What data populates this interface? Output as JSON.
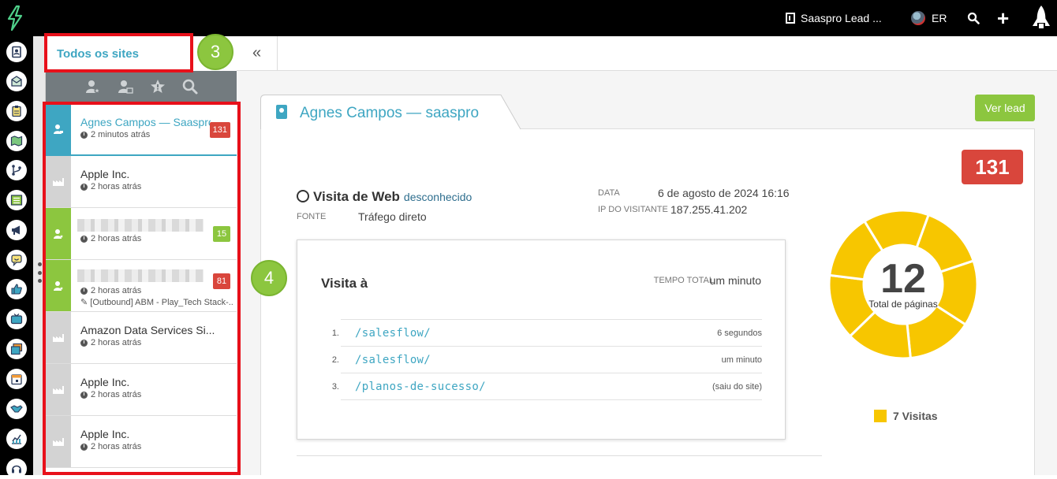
{
  "topbar": {
    "company": "Saaspro Lead ...",
    "user_initials": "ER",
    "icons": [
      "lightning-logo-icon",
      "building-icon",
      "user-avatar-icon",
      "search-icon",
      "plus-icon",
      "rocket-icon"
    ]
  },
  "rail": {
    "icons": [
      "contacts-icon",
      "mail-icon",
      "clipboard-icon",
      "map-icon",
      "workflow-icon",
      "list-icon",
      "megaphone-icon",
      "chat-icon",
      "thumbs-up-icon",
      "tv-icon",
      "gallery-icon",
      "calendar-icon",
      "handshake-icon",
      "chart-icon",
      "headset-icon"
    ]
  },
  "panel": {
    "title": "Todos os sites",
    "filter_icons": [
      "person-star-icon",
      "person-company-icon",
      "star-badge-icon",
      "search-icon"
    ]
  },
  "list": [
    {
      "name": "Agnes Campos — Saaspro",
      "time": "2 minutos atrás",
      "count": "131",
      "count_color": "red",
      "kind": "person",
      "active": true,
      "campaign": ""
    },
    {
      "name": "Apple Inc.",
      "time": "2 horas atrás",
      "count": "",
      "kind": "company",
      "active": false,
      "campaign": ""
    },
    {
      "name": "",
      "time": "2 horas atrás",
      "count": "15",
      "count_color": "green",
      "kind": "person",
      "active": false,
      "campaign": "",
      "blurred": true
    },
    {
      "name": "",
      "time": "2 horas atrás",
      "count": "81",
      "count_color": "red",
      "kind": "person",
      "active": false,
      "campaign": "[Outbound] ABM - Play_Tech Stack-...",
      "blurred": true
    },
    {
      "name": "Amazon Data Services Si...",
      "time": "2 horas atrás",
      "count": "",
      "kind": "company",
      "active": false,
      "campaign": ""
    },
    {
      "name": "Apple Inc.",
      "time": "2 horas atrás",
      "count": "",
      "kind": "company",
      "active": false,
      "campaign": ""
    },
    {
      "name": "Apple Inc.",
      "time": "2 horas atrás",
      "count": "",
      "kind": "company",
      "active": false,
      "campaign": ""
    }
  ],
  "detail": {
    "tab_title": "Agnes Campos — saaspro",
    "view_lead": "Ver lead",
    "visit_type": "Visita de Web",
    "visit_type_sub": "desconhecido",
    "source_label": "FONTE",
    "source_value": "Tráfego direto",
    "date_label": "DATA",
    "date_value": "6 de agosto de 2024 16:16",
    "ip_label": "IP DO VISITANTE",
    "ip_value": "187.255.41.202",
    "visit_title": "Visita à",
    "total_time_label": "TEMPO TOTAL",
    "total_time_value": "um minuto",
    "pages": [
      {
        "num": "1.",
        "path": "/salesflow/",
        "time": "6 segundos"
      },
      {
        "num": "2.",
        "path": "/salesflow/",
        "time": "um minuto"
      },
      {
        "num": "3.",
        "path": "/planos-de-sucesso/",
        "time": "(saiu do site)"
      }
    ],
    "badge": "131",
    "donut_center": "12",
    "donut_label": "Total de páginas",
    "outer_segments": 1,
    "inner_segments": 7,
    "legend": "7 Visitas",
    "colors": {
      "green": "#8cc63f",
      "yellow": "#f7c600",
      "red": "#d9463c",
      "teal": "#3ea6c2"
    }
  },
  "annotations": {
    "step3": "3",
    "step4": "4"
  }
}
